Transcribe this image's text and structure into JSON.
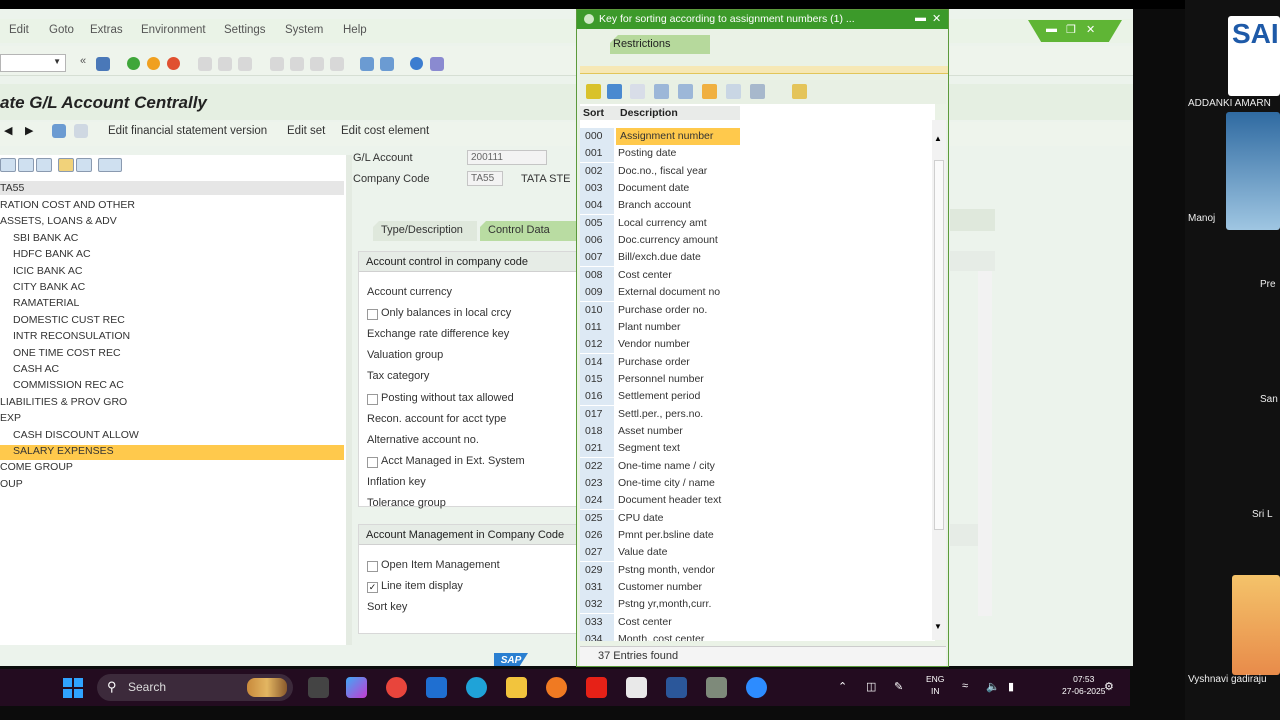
{
  "menu": [
    "Edit",
    "Goto",
    "Extras",
    "Environment",
    "Settings",
    "System",
    "Help"
  ],
  "page_title": "ate G/L Account Centrally",
  "actions": [
    "Edit financial statement version",
    "Edit set",
    "Edit cost element"
  ],
  "tree": {
    "header": "TA55",
    "items": [
      {
        "label": "RATION COST AND OTHER",
        "indent": 0
      },
      {
        "label": "ASSETS, LOANS & ADV",
        "indent": 0
      },
      {
        "label": "SBI BANK AC",
        "indent": 1
      },
      {
        "label": "HDFC BANK AC",
        "indent": 1
      },
      {
        "label": "ICIC BANK AC",
        "indent": 1
      },
      {
        "label": "CITY BANK AC",
        "indent": 1
      },
      {
        "label": "RAMATERIAL",
        "indent": 1
      },
      {
        "label": "DOMESTIC CUST REC",
        "indent": 1
      },
      {
        "label": "INTR RECONSULATION",
        "indent": 1
      },
      {
        "label": "ONE TIME COST REC",
        "indent": 1
      },
      {
        "label": "CASH AC",
        "indent": 1
      },
      {
        "label": "COMMISSION REC AC",
        "indent": 1
      },
      {
        "label": "LIABILITIES & PROV GRO",
        "indent": 0
      },
      {
        "label": "EXP",
        "indent": 0
      },
      {
        "label": "CASH DISCOUNT ALLOW",
        "indent": 1
      },
      {
        "label": "SALARY EXPENSES",
        "indent": 1,
        "selected": true
      },
      {
        "label": "COME GROUP",
        "indent": 0
      },
      {
        "label": "OUP",
        "indent": 0
      }
    ]
  },
  "header_fields": {
    "gl_account_label": "G/L Account",
    "gl_account_value": "200111",
    "company_code_label": "Company Code",
    "company_code_value": "TA55",
    "company_name": "TATA STE"
  },
  "tabs": [
    "Type/Description",
    "Control Data"
  ],
  "control_group": {
    "title": "Account control in company code",
    "rows": [
      {
        "label": "Account currency",
        "checkbox": false
      },
      {
        "label": "Only balances in local crcy",
        "checkbox": true,
        "checked": false
      },
      {
        "label": "Exchange rate difference key",
        "checkbox": false
      },
      {
        "label": "Valuation group",
        "checkbox": false
      },
      {
        "label": "Tax category",
        "checkbox": false
      },
      {
        "label": "Posting without tax allowed",
        "checkbox": true,
        "checked": false
      },
      {
        "label": "Recon. account for acct type",
        "checkbox": false
      },
      {
        "label": "Alternative account no.",
        "checkbox": false
      },
      {
        "label": "Acct Managed in Ext. System",
        "checkbox": true,
        "checked": false
      },
      {
        "label": "Inflation key",
        "checkbox": false
      },
      {
        "label": "Tolerance group",
        "checkbox": false
      }
    ]
  },
  "mgmt_group": {
    "title": "Account Management in Company Code",
    "rows": [
      {
        "label": "Open Item Management",
        "checkbox": true,
        "checked": false
      },
      {
        "label": "Line item display",
        "checkbox": true,
        "checked": true
      },
      {
        "label": "Sort key",
        "checkbox": false
      }
    ]
  },
  "popup": {
    "title": "Key for sorting according to assignment numbers (1) ...",
    "restrictions_tab": "Restrictions",
    "col_sort": "Sort",
    "col_description": "Description",
    "status": "37 Entries found",
    "rows": [
      {
        "key": "000",
        "desc": "Assignment number",
        "selected": true
      },
      {
        "key": "001",
        "desc": "Posting date"
      },
      {
        "key": "002",
        "desc": "Doc.no., fiscal year"
      },
      {
        "key": "003",
        "desc": "Document date"
      },
      {
        "key": "004",
        "desc": "Branch account"
      },
      {
        "key": "005",
        "desc": "Local currency amt"
      },
      {
        "key": "006",
        "desc": "Doc.currency amount"
      },
      {
        "key": "007",
        "desc": "Bill/exch.due date"
      },
      {
        "key": "008",
        "desc": "Cost center"
      },
      {
        "key": "009",
        "desc": "External document no"
      },
      {
        "key": "010",
        "desc": "Purchase order no."
      },
      {
        "key": "011",
        "desc": "Plant number"
      },
      {
        "key": "012",
        "desc": "Vendor number"
      },
      {
        "key": "014",
        "desc": "Purchase order"
      },
      {
        "key": "015",
        "desc": "Personnel number"
      },
      {
        "key": "016",
        "desc": "Settlement period"
      },
      {
        "key": "017",
        "desc": "Settl.per., pers.no."
      },
      {
        "key": "018",
        "desc": "Asset number"
      },
      {
        "key": "021",
        "desc": "Segment text"
      },
      {
        "key": "022",
        "desc": "One-time name / city"
      },
      {
        "key": "023",
        "desc": "One-time city / name"
      },
      {
        "key": "024",
        "desc": "Document header text"
      },
      {
        "key": "025",
        "desc": "CPU date"
      },
      {
        "key": "026",
        "desc": "Pmnt per.bsline date"
      },
      {
        "key": "027",
        "desc": "Value date"
      },
      {
        "key": "029",
        "desc": "Pstng month, vendor"
      },
      {
        "key": "031",
        "desc": "Customer number"
      },
      {
        "key": "032",
        "desc": "Pstng yr,month,curr."
      },
      {
        "key": "033",
        "desc": "Cost center"
      },
      {
        "key": "034",
        "desc": "Month, cost center"
      }
    ]
  },
  "sap_logo": "SAP",
  "taskbar": {
    "search_label": "Search",
    "lang_top": "ENG",
    "lang_bottom": "IN",
    "time": "07:53",
    "date": "27-06-2025"
  },
  "participants": [
    "ADDANKI AMARN",
    "Manoj",
    "Pre",
    "San",
    "Sri L",
    "Vyshnavi gadiraju"
  ],
  "meeting_logo": "SAI FIC",
  "colors": {
    "accent_green": "#3c9a2a",
    "selection": "#ffc94c",
    "tab_active": "#b9dca2"
  }
}
